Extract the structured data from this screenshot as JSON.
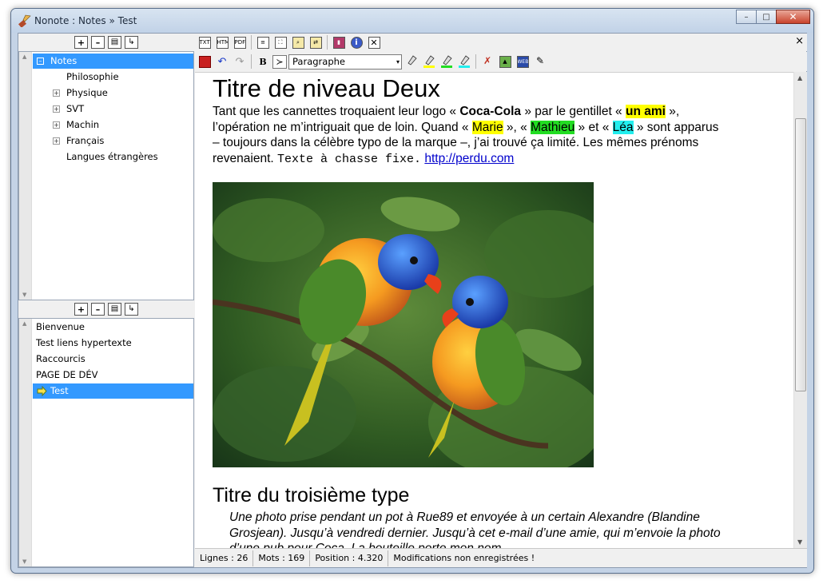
{
  "window": {
    "title": "Nonote : Notes » Test",
    "minimize": "–",
    "maximize": "□",
    "close": "✕"
  },
  "tree": {
    "items": [
      {
        "label": "Notes",
        "selected": true,
        "expander": "–"
      },
      {
        "label": "Philosophie"
      },
      {
        "label": "Physique",
        "expander": "+"
      },
      {
        "label": "SVT",
        "expander": "+"
      },
      {
        "label": "Machin",
        "expander": "+"
      },
      {
        "label": "Français",
        "expander": "+"
      },
      {
        "label": "Langues étrangères"
      }
    ]
  },
  "notes_list": {
    "items": [
      "Bienvenue",
      "Test liens hypertexte",
      "Raccourcis",
      "PAGE DE DÉV",
      "Test"
    ],
    "selected": "Test"
  },
  "toolbar": {
    "close_label": "×",
    "bold_label": "B",
    "style_value": "Paragraphe",
    "style_arrow": "▾",
    "terminal_label": "≻"
  },
  "document": {
    "heading2": "Titre de niveau Deux",
    "para1": {
      "t1": "Tant que les cannettes troquaient leur logo « ",
      "b1": "Coca-Cola",
      "t2": " » par le gentillet « ",
      "b2": "un ami",
      "t3": " », l’opération ne m’intriguait que de loin. Quand « ",
      "n1": "Marie",
      "t4": " », « ",
      "n2": "Mathieu",
      "t5": " » et « ",
      "n3": "Léa",
      "t6": " » sont apparus – toujours dans la célèbre typo de la marque –, j’ai trouvé ça limité. Les mêmes prénoms revenaient. ",
      "mono": "Texte à chasse fixe.",
      "t7": " ",
      "link": "http://perdu.com"
    },
    "heading3": "Titre du troisième type",
    "quote": "Une photo prise pendant un pot à Rue89 et envoyée à un certain Alexandre (Blandine Grosjean). Jusqu’à vendredi dernier. Jusqu’à cet e-mail d’une amie, qui m’envoie la photo d’une pub pour Coca. La bouteille porte mon nom"
  },
  "status": {
    "lines": "Lignes :  26",
    "words": "Mots :  169",
    "position": "Position :  4.320",
    "modified": "Modifications non enregistrées !"
  },
  "colors": {
    "selection": "#3399ff",
    "highlight_yellow": "#ffff00",
    "highlight_green": "#22dd22",
    "highlight_cyan": "#22eeee",
    "link": "#0000cc"
  }
}
